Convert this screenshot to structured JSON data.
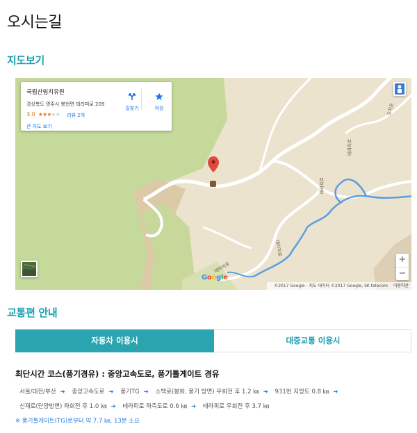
{
  "page": {
    "title": "오시는길"
  },
  "sections": {
    "map_title": "지도보기",
    "transit_title": "교통편 안내"
  },
  "map": {
    "info_card": {
      "name": "국립산림치유원",
      "address": "경상북도 영주시 봉현면 테라피로 209",
      "rating": "3.0",
      "stars_filled": 3,
      "stars_total": 5,
      "reviews": "리뷰 2개",
      "larger_map": "큰 지도 보기",
      "directions_label": "길찾기",
      "save_label": "저장"
    },
    "road_labels": {
      "therapy_right": "테라피로",
      "therapy_mid": "테라피로",
      "therapy_bottom": "테라피로",
      "therapy_far_right": "테라피로",
      "ochi": "오치로"
    },
    "zoom": {
      "in": "+",
      "out": "−"
    },
    "logo": "Google",
    "footer": {
      "copyright": "©2017 Google - 지도 데이터 ©2017 Google, SK telecom",
      "terms": "이용약관"
    },
    "colors": {
      "land": "#ece3cf",
      "forest": "#c5d99a",
      "water": "#5a9de0",
      "pin": "#e04a3c"
    }
  },
  "tabs": [
    {
      "label": "자동차 이용시",
      "active": true
    },
    {
      "label": "대중교통 이용시",
      "active": false
    }
  ],
  "route": {
    "title": "최단시간 코스(풍기경유) : 중앙고속도로, 풍기톨게이트 경유",
    "line1": [
      "서울/대전/부산",
      "중앙고속도로",
      "풍기TG",
      "소백로(봉화, 풍기 방면) 우회전 후 1.2 ㎞",
      "931번 지방도 0.8 ㎞"
    ],
    "line2": [
      "신재로(단양방면) 좌회전 후 1.0 ㎞",
      "테라피로 좌측도로 0.6 ㎞",
      "테라피로 우회전 후 3.7 ㎞"
    ],
    "note": "※ 풍기톨게이트(TG)로부터 약 7.7 ㎞, 13분 소요"
  },
  "colors": {
    "accent": "#2aa5b0",
    "arrow": "#2a7de1",
    "title_color": "#1a9fb0"
  }
}
